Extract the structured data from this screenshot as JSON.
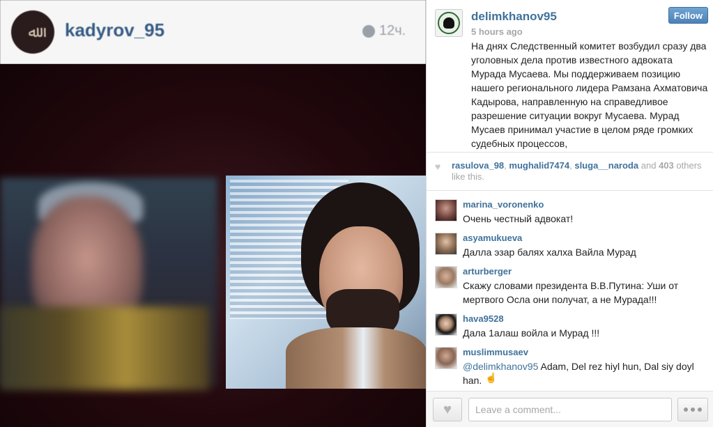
{
  "photo": {
    "embedded_username": "kadyrov_95",
    "embedded_time": "12ч."
  },
  "post": {
    "username": "delimkhanov95",
    "time": "5 hours ago",
    "follow_label": "Follow",
    "caption": "На днях Следственный комитет возбудил сразу два уголовных дела против известного адвоката Мурада Мусаева. Мы поддерживаем позицию нашего регионального лидера Рамзана Ахматовича Кадырова, направленную на справедливое разрешение ситуации вокруг Мусаева. Мурад Мусаев принимал участие в целом ряде громких судебных процессов,"
  },
  "likes": {
    "likers": [
      "rasulova_98",
      "mughalid7474",
      "sluga__naroda"
    ],
    "and_word": "and",
    "count": "403",
    "suffix": "others like this."
  },
  "comments": [
    {
      "user": "marina_voronenko",
      "text": "Очень честный адвокат!"
    },
    {
      "user": "asyamukueva",
      "text": "Далла эзар балях халха Вайла Мурад"
    },
    {
      "user": "arturberger",
      "text": "Скажу словами президента В.В.Путина: Уши от мертвого Осла они получат, а не Мурада!!!"
    },
    {
      "user": "hava9528",
      "text": "Дала 1алаш войла и Мурад !!!"
    },
    {
      "user": "muslimmusaev",
      "mention": "@delimkhanov95",
      "text": "Adam, Del rez hiyl hun, Dal siy doyl han."
    }
  ],
  "comment_bar": {
    "placeholder": "Leave a comment...",
    "like_icon": "heart-icon",
    "more_icon": "more-dots-icon"
  },
  "colors": {
    "link_blue": "#3f729b",
    "follow_blue": "#4d82b8",
    "muted_gray": "#a5a7aa"
  }
}
